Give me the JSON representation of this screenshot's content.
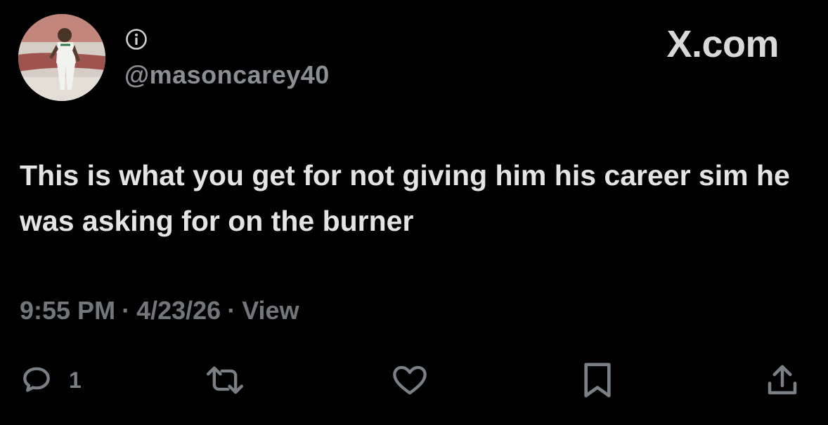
{
  "profile": {
    "avatar": "avatar-photo-basketball-player",
    "handle": "@masoncarey40"
  },
  "icons": {
    "info": "info-icon",
    "reply": "comment-bubble-icon",
    "retweet": "retweet-icon",
    "like": "heart-icon",
    "bookmark": "bookmark-icon",
    "share": "share-upload-icon"
  },
  "brand": "X.com",
  "tweet": {
    "text": "This is what you get for not giving him his career sim he was asking for on the burner",
    "time": "9:55 PM",
    "date": "4/23/26",
    "views_label": "View",
    "separator": "·"
  },
  "actions": {
    "reply_count": "1"
  },
  "colors": {
    "background": "#000000",
    "text": "#e7e9ea",
    "muted": "#73777c",
    "icon": "#7b8086"
  }
}
